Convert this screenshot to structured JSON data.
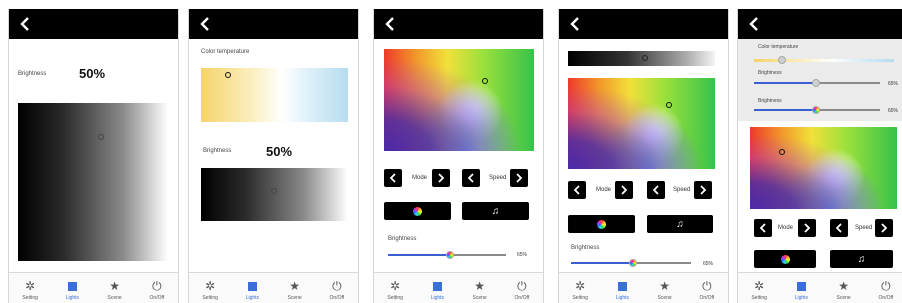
{
  "tabs": [
    {
      "label": "Setting",
      "icon": "gear-icon"
    },
    {
      "label": "Lights",
      "icon": "lights-icon"
    },
    {
      "label": "Scene",
      "icon": "star-icon"
    },
    {
      "label": "On/Off",
      "icon": "power-icon"
    }
  ],
  "active_tab": "Lights",
  "screen1": {
    "brightness_label": "Brightness",
    "brightness_value": "50%"
  },
  "screen2": {
    "color_temp_label": "Color temperature",
    "brightness_label": "Brightness",
    "brightness_value": "50%"
  },
  "screen3": {
    "mode_label": "Mode",
    "speed_label": "Speed",
    "brightness_label": "Brightness",
    "brightness_value": "65%",
    "music_glyph": "♫"
  },
  "screen4": {
    "mode_label": "Mode",
    "speed_label": "Speed",
    "brightness_label": "Brightness",
    "brightness_value": "65%",
    "music_glyph": "♫"
  },
  "screen5": {
    "color_temp_label": "Color temperature",
    "brightness_label_1": "Brightness",
    "brightness_value_1": "65%",
    "brightness_label_2": "Brightness",
    "brightness_value_2": "65%",
    "mode_label": "Mode",
    "speed_label": "Speed",
    "music_glyph": "♫"
  },
  "colors": {
    "accent": "#3a6fd8",
    "topbar": "#000000"
  }
}
